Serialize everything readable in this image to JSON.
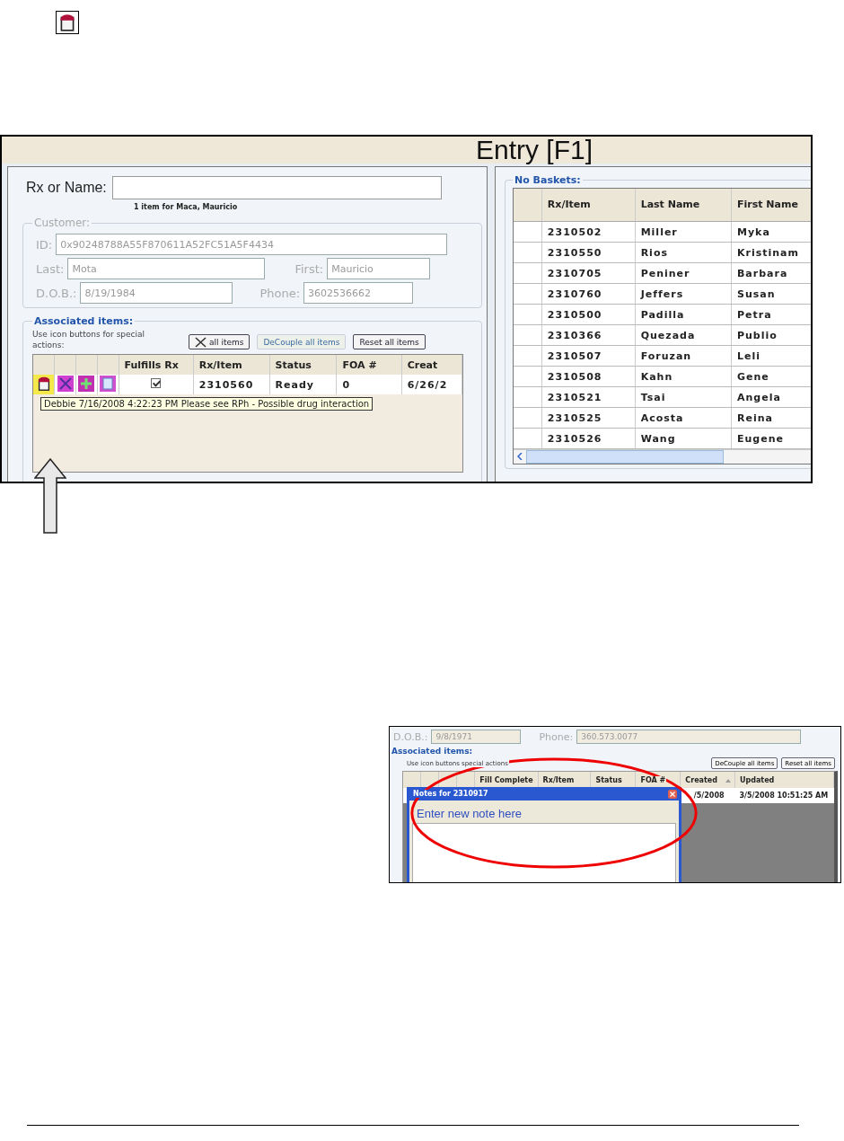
{
  "entry_window": {
    "title": "Entry [F1]",
    "rx_label": "Rx or Name:",
    "match_info": "1 item for Maca, Mauricio",
    "customer": {
      "legend": "Customer:",
      "id_label": "ID:",
      "id_value": "0x90248788A55F870611A52FC51A5F4434",
      "last_label": "Last:",
      "last_value": "Mota",
      "first_label": "First:",
      "first_value": "Mauricio",
      "dob_label": "D.O.B.:",
      "dob_value": "8/19/1984",
      "phone_label": "Phone:",
      "phone_value": "3602536662"
    },
    "associated": {
      "legend": "Associated items:",
      "hint": "Use icon buttons for special actions:",
      "buttons": [
        {
          "kind": "clear",
          "label": "all items",
          "disabled": false
        },
        {
          "kind": "text",
          "label": "DeCouple all items",
          "disabled": true
        },
        {
          "kind": "text",
          "label": "Reset all items",
          "disabled": false
        }
      ],
      "columns": [
        "Fulfills Rx",
        "Rx/Item",
        "Status",
        "FOA #",
        "Creat"
      ],
      "rows": [
        {
          "cells": [
            {
              "kind": "checkbox",
              "checked": true
            },
            {
              "kind": "text",
              "text": "2310560"
            },
            {
              "kind": "text",
              "text": "Ready"
            },
            {
              "kind": "text",
              "text": "0"
            },
            {
              "kind": "text",
              "text": "6/26/2"
            }
          ]
        }
      ],
      "tooltip": "Debbie 7/16/2008 4:22:23 PM Please see RPh - Possible drug interaction"
    },
    "baskets": {
      "legend": "No Baskets:",
      "columns": [
        "Rx/Item",
        "Last Name",
        "First Name"
      ],
      "rows": [
        [
          "2310502",
          "Miller",
          "Myka"
        ],
        [
          "2310550",
          "Rios",
          "Kristinam"
        ],
        [
          "2310705",
          "Peniner",
          "Barbara"
        ],
        [
          "2310760",
          "Jeffers",
          "Susan"
        ],
        [
          "2310500",
          "Padilla",
          "Petra"
        ],
        [
          "2310366",
          "Quezada",
          "Publio"
        ],
        [
          "2310507",
          "Foruzan",
          "Leli"
        ],
        [
          "2310508",
          "Kahn",
          "Gene"
        ],
        [
          "2310521",
          "Tsai",
          "Angela"
        ],
        [
          "2310525",
          "Acosta",
          "Reina"
        ],
        [
          "2310526",
          "Wang",
          "Eugene"
        ]
      ]
    }
  },
  "notes_window": {
    "dob_label": "D.O.B.:",
    "dob_value": "9/8/1971",
    "phone_label": "Phone:",
    "phone_value": "360.573.0077",
    "legend": "Associated items:",
    "hint": "Use icon buttons special actions",
    "buttons": [
      {
        "label": "DeCouple all items"
      },
      {
        "label": "Reset all items"
      }
    ],
    "columns": [
      {
        "label": "Fill Complete",
        "sorted": false
      },
      {
        "label": "Rx/Item",
        "sorted": false
      },
      {
        "label": "Status",
        "sorted": false
      },
      {
        "label": "FOA #",
        "sorted": false
      },
      {
        "label": "Created",
        "sorted": true
      },
      {
        "label": "Updated",
        "sorted": false
      }
    ],
    "row": {
      "created": "/5/2008",
      "updated": "3/5/2008 10:51:25 AM"
    },
    "dialog": {
      "title": "Notes for 2310917",
      "prompt": "Enter new note here"
    }
  }
}
